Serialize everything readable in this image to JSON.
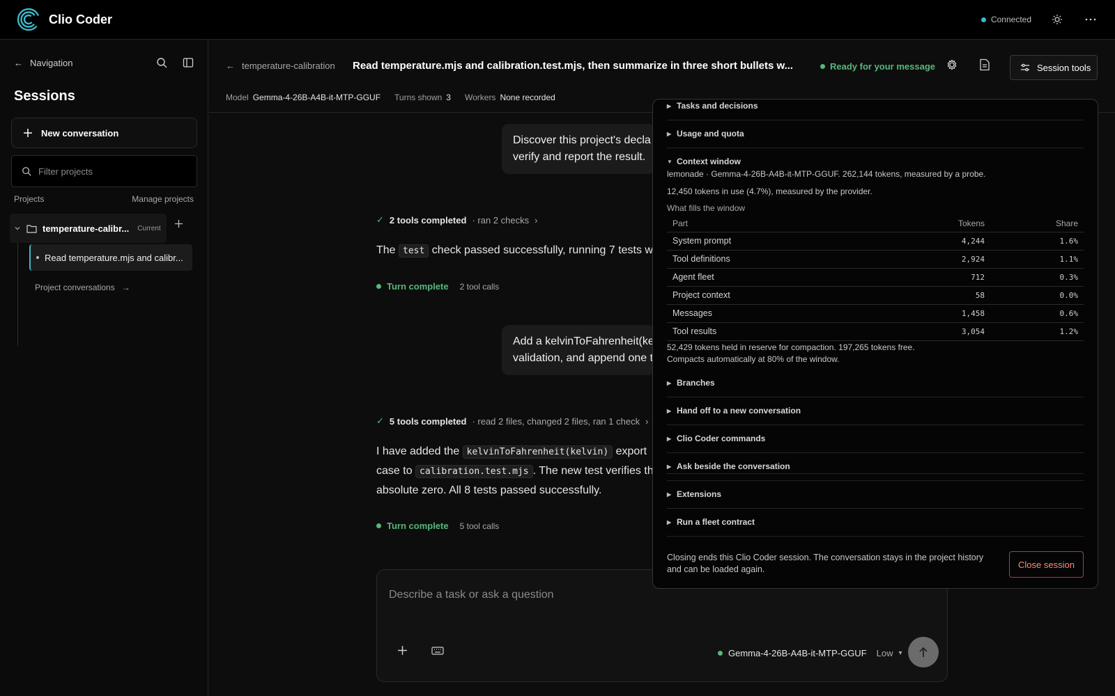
{
  "app": {
    "name": "Clio Coder",
    "connection": "Connected",
    "connection_color": "#3fb8c9"
  },
  "sidebar": {
    "nav_label": "Navigation",
    "title": "Sessions",
    "new_conversation": "New conversation",
    "filter_placeholder": "Filter projects",
    "projects_label": "Projects",
    "manage_projects": "Manage projects",
    "project": {
      "name": "temperature-calibr...",
      "badge": "Current"
    },
    "session_item": "Read temperature.mjs and calibr...",
    "project_conversations": "Project conversations",
    "project_conversations_arrow": "→"
  },
  "header": {
    "breadcrumb": "temperature-calibration",
    "title": "Read temperature.mjs and calibration.test.mjs, then summarize in three short bullets w...",
    "status": "Ready for your message",
    "status_color": "#57b87a",
    "session_tools": "Session tools",
    "meta": {
      "model_label": "Model",
      "model": "Gemma-4-26B-A4B-it-MTP-GGUF",
      "turns_label": "Turns shown",
      "turns": "3",
      "workers_label": "Workers",
      "workers": "None recorded"
    }
  },
  "chat": {
    "msg1": {
      "line1": "Discover this project's decla",
      "line2": "verify and report the result."
    },
    "tools1": {
      "check": "✓",
      "title": "2 tools completed",
      "detail": "· ran 2 checks",
      "chevron": "›"
    },
    "reply1": {
      "pre": "The",
      "code": "test",
      "post": "check passed successfully, running 7 tests w"
    },
    "turn1": {
      "label": "Turn complete",
      "calls": "2 tool calls"
    },
    "msg2": {
      "line1": "Add a kelvinToFahrenheit(ke",
      "line2": "validation, and append one t"
    },
    "tools2": {
      "check": "✓",
      "title": "5 tools completed",
      "detail": "· read 2 files, changed 2 files, ran 1 check",
      "chevron": "›"
    },
    "reply2": {
      "l1_pre": "I have added the",
      "l1_code": "kelvinToFahrenheit(kelvin)",
      "l1_post": "export",
      "l2_pre": "case to",
      "l2_code": "calibration.test.mjs",
      "l2_post": ". The new test verifies th",
      "l3": "absolute zero. All 8 tests passed successfully."
    },
    "turn2": {
      "label": "Turn complete",
      "calls": "5 tool calls"
    }
  },
  "composer": {
    "placeholder": "Describe a task or ask a question",
    "model": "Gemma-4-26B-A4B-it-MTP-GGUF",
    "level": "Low",
    "level_caret": "▾"
  },
  "panel": {
    "sections_top": [
      "Tasks and decisions",
      "Usage and quota"
    ],
    "context": {
      "title": "Context window",
      "line1": "lemonade · Gemma-4-26B-A4B-it-MTP-GGUF. 262,144 tokens, measured by a probe.",
      "line2": "12,450 tokens in use (4.7%), measured by the provider.",
      "fills": "What fills the window",
      "columns": [
        "Part",
        "Tokens",
        "Share"
      ],
      "rows": [
        [
          "System prompt",
          "4,244",
          "1.6%"
        ],
        [
          "Tool definitions",
          "2,924",
          "1.1%"
        ],
        [
          "Agent fleet",
          "712",
          "0.3%"
        ],
        [
          "Project context",
          "58",
          "0.0%"
        ],
        [
          "Messages",
          "1,458",
          "0.6%"
        ],
        [
          "Tool results",
          "3,054",
          "1.2%"
        ]
      ],
      "reserve": "52,429 tokens held in reserve for compaction. 197,265 tokens free.",
      "compacts": "Compacts automatically at 80% of the window."
    },
    "sections_bottom": [
      "Branches",
      "Hand off to a new conversation",
      "Clio Coder commands",
      "Ask beside the conversation",
      "Extensions",
      "Run a fleet contract"
    ],
    "close_note": "Closing ends this Clio Coder session. The conversation stays in the project history and can be loaded again.",
    "close_button": "Close session"
  }
}
